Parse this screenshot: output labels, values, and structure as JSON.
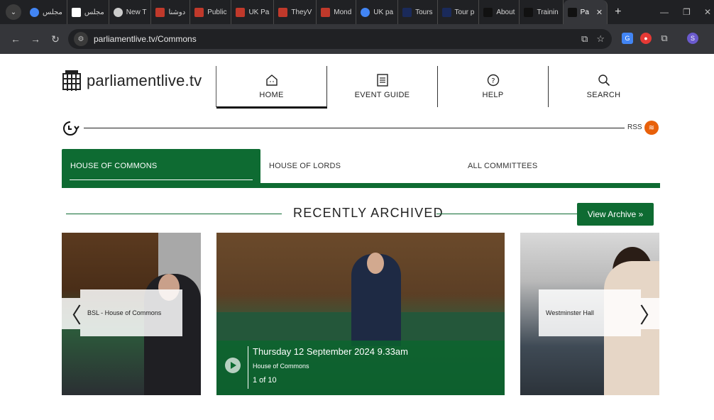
{
  "browser": {
    "tabs": [
      {
        "label": "مجلس",
        "color": "#4285f4"
      },
      {
        "label": "مجلس",
        "color": "#ffffff"
      },
      {
        "label": "New T",
        "color": "#cccccc"
      },
      {
        "label": "دوشنا",
        "color": "#c0392b"
      },
      {
        "label": "Public",
        "color": "#c0392b"
      },
      {
        "label": "UK Pa",
        "color": "#c0392b"
      },
      {
        "label": "TheyV",
        "color": "#c0392b"
      },
      {
        "label": "Mond",
        "color": "#c0392b"
      },
      {
        "label": "UK pa",
        "color": "#4285f4"
      },
      {
        "label": "Tours",
        "color": "#1a2a5a"
      },
      {
        "label": "Tour p",
        "color": "#1a2a5a"
      },
      {
        "label": "About",
        "color": "#111111"
      },
      {
        "label": "Trainin",
        "color": "#111111"
      },
      {
        "label": "Pa",
        "color": "#111111",
        "active": true
      }
    ],
    "url": "parliamentlive.tv/Commons",
    "profile_initial": "S"
  },
  "site": {
    "logo_text": "parliamentlive.tv",
    "nav": [
      {
        "label": "HOME",
        "icon": "home-icon",
        "active": true
      },
      {
        "label": "EVENT GUIDE",
        "icon": "document-icon"
      },
      {
        "label": "HELP",
        "icon": "help-icon"
      },
      {
        "label": "SEARCH",
        "icon": "search-icon"
      }
    ],
    "rss_label": "RSS",
    "house_tabs": [
      {
        "label": "HOUSE OF COMMONS",
        "active": true
      },
      {
        "label": "HOUSE OF LORDS"
      },
      {
        "label": "ALL COMMITTEES"
      }
    ],
    "recently_archived": {
      "title": "RECENTLY ARCHIVED",
      "button_label": "View Archive »"
    },
    "carousel": {
      "left_caption": "BSL - House of Commons",
      "main": {
        "date": "Thursday 12 September 2024 9.33am",
        "house": "House of Commons",
        "counter": "1 of 10"
      },
      "right_caption": "Westminster Hall"
    },
    "colors": {
      "brand_green": "#0e6b32",
      "rss_orange": "#e8600a"
    }
  }
}
